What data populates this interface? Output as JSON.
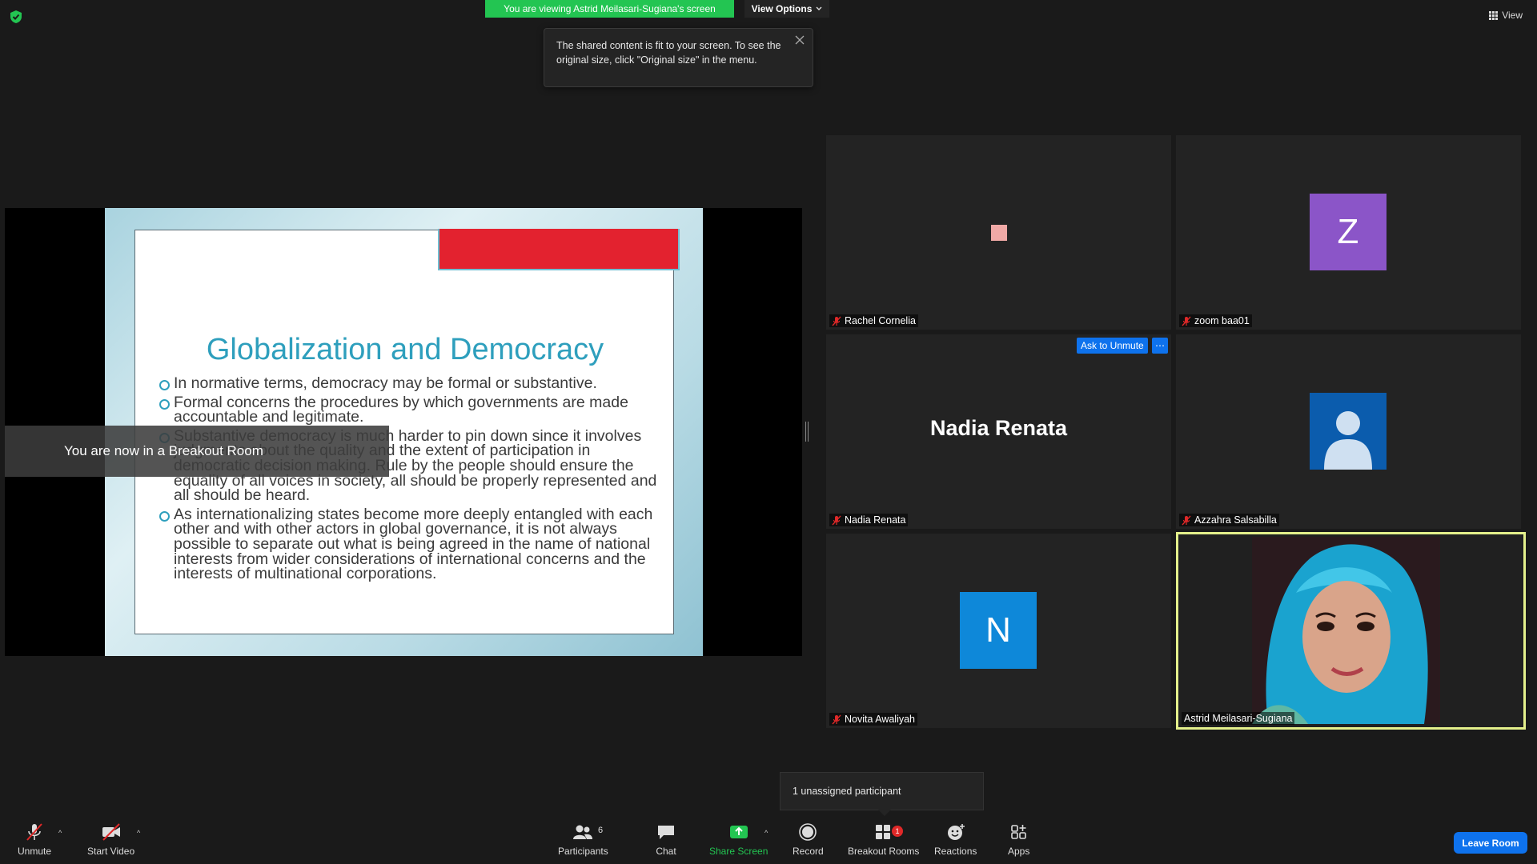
{
  "top": {
    "banner": "You are viewing Astrid Meilasari-Sugiana's screen",
    "view_options": "View Options",
    "tooltip": "The shared content is fit to your screen. To see the original size, click \"Original size\" in the menu.",
    "view_label": "View"
  },
  "slide": {
    "title": "Globalization and Democracy",
    "bullets": [
      "In normative terms, democracy may be formal or substantive.",
      "Formal concerns the procedures by which governments are made accountable and legitimate.",
      "Substantive democracy is much harder to pin down since it involves judgments about the quality and the extent of participation in democratic decision making.  Rule by the people should ensure the equality of all voices in society, all should be properly represented and all should be heard.",
      "As internationalizing states become more deeply entangled with each other and with other actors in global governance, it is not always possible to separate out what is being agreed in the name of national interests from wider considerations of international concerns and the interests of multinational corporations."
    ],
    "breakout_toast": "You are now in a Breakout Room"
  },
  "participants": {
    "tiles": [
      {
        "name": "Rachel Cornelia",
        "muted": true
      },
      {
        "name": "zoom baa01",
        "muted": true,
        "initial": "Z",
        "color": "#8b55c8"
      },
      {
        "name": "Nadia Renata",
        "muted": true,
        "big_name": "Nadia Renata"
      },
      {
        "name": "Azzahra Salsabilla",
        "muted": true,
        "color": "#0b5cad"
      },
      {
        "name": "Novita Awaliyah",
        "muted": true,
        "initial": "N",
        "color": "#0e88d9"
      },
      {
        "name": "Astrid Meilasari-Sugiana",
        "muted": false,
        "active_speaker": true
      }
    ],
    "ask_to_unmute": "Ask to Unmute",
    "more": "⋯"
  },
  "unassigned": "1 unassigned participant",
  "toolbar": {
    "unmute": "Unmute",
    "start_video": "Start Video",
    "participants": "Participants",
    "participants_count": "6",
    "chat": "Chat",
    "share_screen": "Share Screen",
    "record": "Record",
    "breakout_rooms": "Breakout Rooms",
    "breakout_badge": "1",
    "reactions": "Reactions",
    "apps": "Apps",
    "leave": "Leave Room"
  },
  "colors": {
    "share_green": "#23c552",
    "accent_blue": "#0e72ed",
    "speaker_border": "#e4f08b",
    "muted_red": "#e02828"
  }
}
